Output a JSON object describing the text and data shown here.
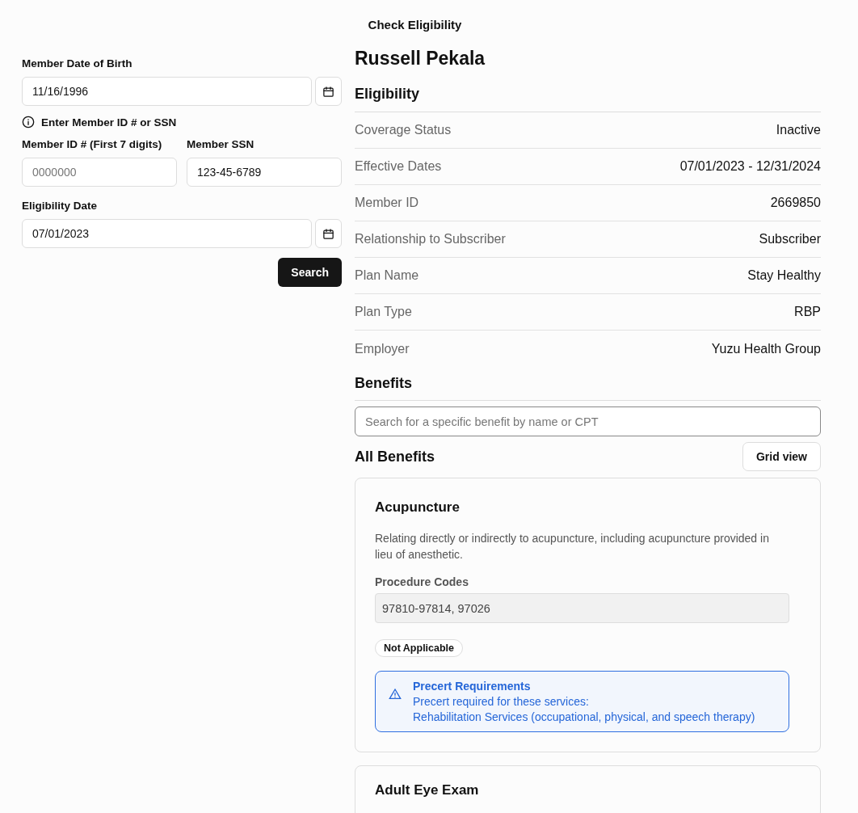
{
  "page_title": "Check Eligibility",
  "form": {
    "dob": {
      "label": "Member Date of Birth",
      "value": "11/16/1996"
    },
    "hint": "Enter Member ID # or SSN",
    "member_id": {
      "label": "Member ID # (First 7 digits)",
      "placeholder": "0000000"
    },
    "ssn": {
      "label": "Member SSN",
      "value": "123-45-6789"
    },
    "eligibility_date": {
      "label": "Eligibility Date",
      "value": "07/01/2023"
    },
    "search_button": "Search"
  },
  "member_name": "Russell Pekala",
  "eligibility": {
    "heading": "Eligibility",
    "rows": [
      {
        "label": "Coverage Status",
        "value": "Inactive"
      },
      {
        "label": "Effective Dates",
        "value": "07/01/2023 - 12/31/2024"
      },
      {
        "label": "Member ID",
        "value": "2669850"
      },
      {
        "label": "Relationship to Subscriber",
        "value": "Subscriber"
      },
      {
        "label": "Plan Name",
        "value": "Stay Healthy"
      },
      {
        "label": "Plan Type",
        "value": "RBP"
      },
      {
        "label": "Employer",
        "value": "Yuzu Health Group"
      }
    ]
  },
  "benefits": {
    "heading": "Benefits",
    "search_placeholder": "Search for a specific benefit by name or CPT",
    "list_heading": "All Benefits",
    "view_button": "Grid view",
    "cards": [
      {
        "title": "Acupuncture",
        "description": "Relating directly or indirectly to acupuncture, including acupuncture provided in lieu of anesthetic.",
        "codes_label": "Procedure Codes",
        "codes": "97810-97814, 97026",
        "badge": "Not Applicable",
        "alert": {
          "title": "Precert Requirements",
          "lines": [
            "Precert required for these services:",
            "Rehabilitation Services (occupational, physical, and speech therapy)"
          ]
        }
      },
      {
        "title": "Adult Eye Exam"
      }
    ]
  }
}
